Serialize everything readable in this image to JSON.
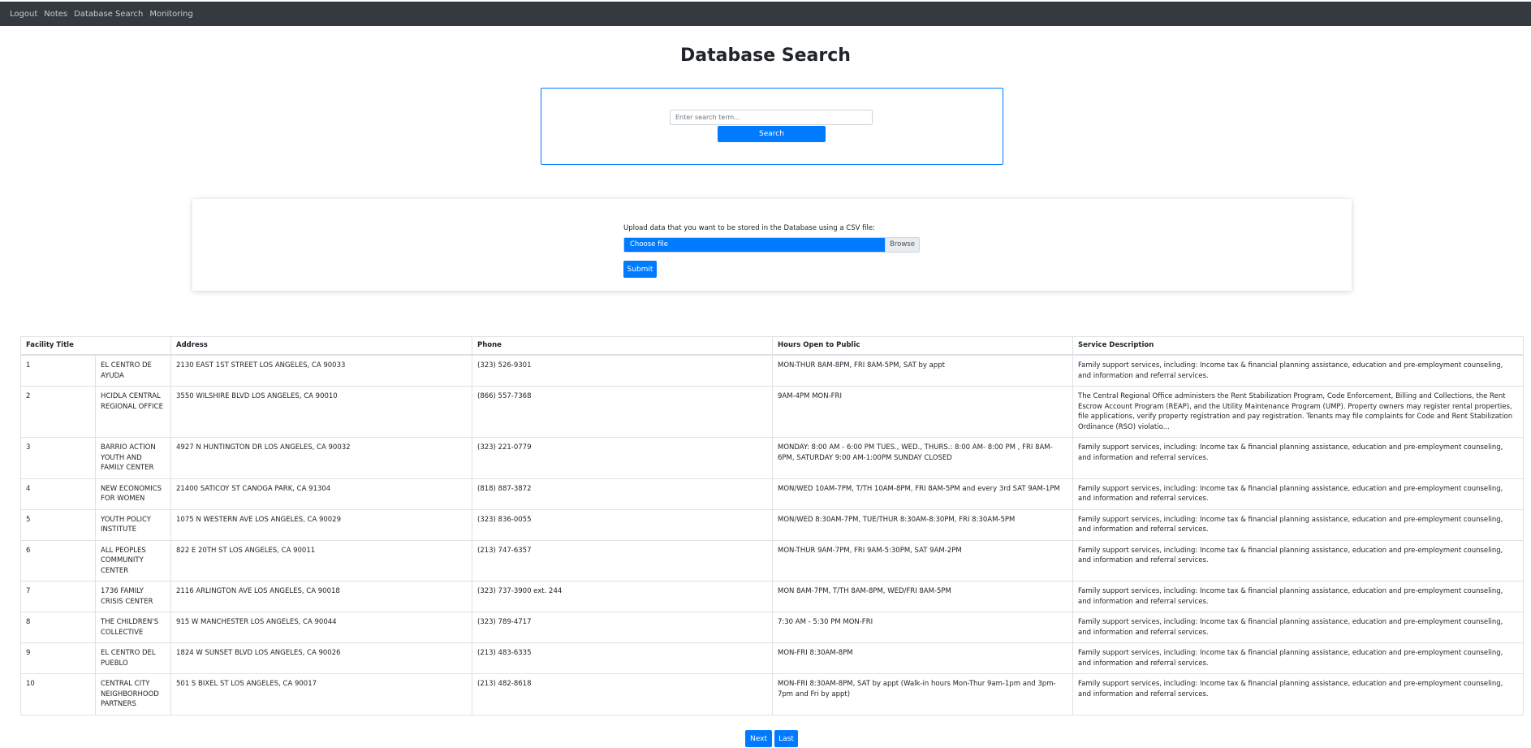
{
  "nav": {
    "items": [
      "Logout",
      "Notes",
      "Database Search",
      "Monitoring"
    ]
  },
  "page": {
    "title": "Database Search"
  },
  "search": {
    "placeholder": "Enter search term...",
    "button_label": "Search"
  },
  "upload": {
    "label": "Upload data that you want to be stored in the Database using a CSV file:",
    "file_label": "Choose file",
    "browse_label": "Browse",
    "submit_label": "Submit"
  },
  "table": {
    "headers": [
      "Facility Title",
      "Address",
      "Phone",
      "Hours Open to Public",
      "Service Description"
    ],
    "rows": [
      {
        "id": "1",
        "name": "EL CENTRO DE AYUDA",
        "address": "2130 EAST 1ST STREET LOS ANGELES, CA 90033",
        "phone": "(323) 526-9301",
        "hours": "MON-THUR 8AM-8PM, FRI 8AM-5PM, SAT by appt",
        "desc": "Family support services, including: Income tax & financial planning assistance, education and pre-employment counseling, and information and referral services."
      },
      {
        "id": "2",
        "name": "HCIDLA CENTRAL REGIONAL OFFICE",
        "address": "3550 WILSHIRE BLVD LOS ANGELES, CA 90010",
        "phone": "(866) 557-7368",
        "hours": "9AM-4PM MON-FRI",
        "desc": "The Central Regional Office administers the Rent Stabilization Program, Code Enforcement, Billing and Collections, the Rent Escrow Account Program (REAP), and the Utility Maintenance Program (UMP). Property owners may register rental properties, file applications, verify property registration and pay registration. Tenants may file complaints for Code and Rent Stabilization Ordinance (RSO) violatio..."
      },
      {
        "id": "3",
        "name": "BARRIO ACTION YOUTH AND FAMILY CENTER",
        "address": "4927 N HUNTINGTON DR LOS ANGELES, CA 90032",
        "phone": "(323) 221-0779",
        "hours": "MONDAY: 8:00 AM - 6:00 PM TUES., WED., THURS.: 8:00 AM- 8:00 PM , FRI 8AM-6PM, SATURDAY 9:00 AM-1:00PM SUNDAY CLOSED",
        "desc": "Family support services, including: Income tax & financial planning assistance, education and pre-employment counseling, and information and referral services."
      },
      {
        "id": "4",
        "name": "NEW ECONOMICS FOR WOMEN",
        "address": "21400 SATICOY ST CANOGA PARK, CA 91304",
        "phone": "(818) 887-3872",
        "hours": "MON/WED 10AM-7PM, T/TH 10AM-8PM, FRI 8AM-5PM and every 3rd SAT 9AM-1PM",
        "desc": "Family support services, including: Income tax & financial planning assistance, education and pre-employment counseling, and information and referral services."
      },
      {
        "id": "5",
        "name": "YOUTH POLICY INSTITUTE",
        "address": "1075 N WESTERN AVE LOS ANGELES, CA 90029",
        "phone": "(323) 836-0055",
        "hours": "MON/WED 8:30AM-7PM, TUE/THUR 8:30AM-8:30PM, FRI 8:30AM-5PM",
        "desc": "Family support services, including: Income tax & financial planning assistance, education and pre-employment counseling, and information and referral services."
      },
      {
        "id": "6",
        "name": "ALL PEOPLES COMMUNITY CENTER",
        "address": "822 E 20TH ST LOS ANGELES, CA 90011",
        "phone": "(213) 747-6357",
        "hours": "MON-THUR 9AM-7PM, FRI 9AM-5:30PM, SAT 9AM-2PM",
        "desc": "Family support services, including: Income tax & financial planning assistance, education and pre-employment counseling, and information and referral services."
      },
      {
        "id": "7",
        "name": "1736 FAMILY CRISIS CENTER",
        "address": "2116 ARLINGTON AVE LOS ANGELES, CA 90018",
        "phone": "(323) 737-3900 ext. 244",
        "hours": "MON 8AM-7PM, T/TH 8AM-8PM, WED/FRI 8AM-5PM",
        "desc": "Family support services, including: Income tax & financial planning assistance, education and pre-employment counseling, and information and referral services."
      },
      {
        "id": "8",
        "name": "THE CHILDREN'S COLLECTIVE",
        "address": "915 W MANCHESTER LOS ANGELES, CA 90044",
        "phone": "(323) 789-4717",
        "hours": "7:30 AM - 5:30 PM MON-FRI",
        "desc": "Family support services, including: Income tax & financial planning assistance, education and pre-employment counseling, and information and referral services."
      },
      {
        "id": "9",
        "name": "EL CENTRO DEL PUEBLO",
        "address": "1824 W SUNSET BLVD LOS ANGELES, CA 90026",
        "phone": "(213) 483-6335",
        "hours": "MON-FRI 8:30AM-8PM",
        "desc": "Family support services, including: Income tax & financial planning assistance, education and pre-employment counseling, and information and referral services."
      },
      {
        "id": "10",
        "name": "CENTRAL CITY NEIGHBORHOOD PARTNERS",
        "address": "501 S BIXEL ST LOS ANGELES, CA 90017",
        "phone": "(213) 482-8618",
        "hours": "MON-FRI 8:30AM-8PM, SAT by appt (Walk-in hours Mon-Thur 9am-1pm and 3pm-7pm and Fri by appt)",
        "desc": "Family support services, including: Income tax & financial planning assistance, education and pre-employment counseling, and information and referral services."
      }
    ]
  },
  "pagination": {
    "next_label": "Next",
    "last_label": "Last"
  },
  "colors": {
    "navbar": "#343a40",
    "primary": "#007bff",
    "border": "#dee2e6"
  }
}
